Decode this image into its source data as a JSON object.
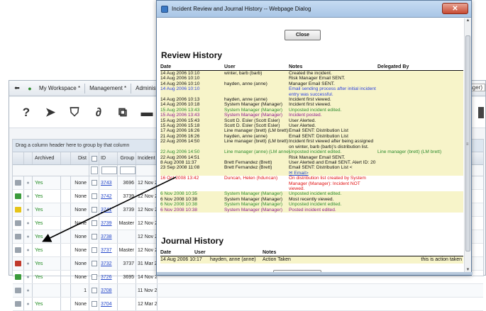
{
  "background_app": {
    "nav": {
      "items": [
        "My Workspace *",
        "Management *",
        "Administration"
      ],
      "right_tab": "ager)"
    },
    "toolbar": {
      "icons": [
        "link-icon",
        "send-icon",
        "bookmark-icon",
        "attach-icon",
        "copy-icon",
        "archive-icon",
        "delete-icon"
      ]
    },
    "grid": {
      "drag_hint": "Drag a column header here to group by that column",
      "headers": {
        "archived": "Archived",
        "dist": "Dist",
        "id": "ID",
        "group": "Group",
        "date": "Incident"
      },
      "rows": [
        {
          "archived": "Yes",
          "dist": "None",
          "id": "3743",
          "group": "3696",
          "date": "12 Nov 2"
        },
        {
          "archived": "Yes",
          "dist": "None",
          "id": "3742",
          "group": "3739",
          "date": "12 Nov 2"
        },
        {
          "archived": "Yes",
          "dist": "None",
          "id": "3741",
          "group": "3739",
          "date": "12 Nov 2"
        },
        {
          "archived": "Yes",
          "dist": "None",
          "id": "3739",
          "group": "Master",
          "date": "12 Nov 2"
        },
        {
          "archived": "Yes",
          "dist": "None",
          "id": "3738",
          "group": "",
          "date": "12 Nov 2"
        },
        {
          "archived": "Yes",
          "dist": "None",
          "id": "3737",
          "group": "Master",
          "date": "12 Nov 2"
        },
        {
          "archived": "Yes",
          "dist": "None",
          "id": "3732",
          "group": "3737",
          "date": "31 Mar 2"
        },
        {
          "archived": "Yes",
          "dist": "None",
          "id": "3726",
          "group": "3695",
          "date": "14 Nov 2"
        },
        {
          "archived": "",
          "dist": "1",
          "id": "3708",
          "group": "",
          "date": "11 Nov 2"
        },
        {
          "archived": "Yes",
          "dist": "None",
          "id": "3704",
          "group": "",
          "date": "12 Mar 2"
        }
      ]
    }
  },
  "dialog": {
    "title": "Incident Review and Journal History -- Webpage Dialog",
    "close_button": "Close",
    "review": {
      "heading": "Review History",
      "columns": {
        "date": "Date",
        "user": "User",
        "notes": "Notes",
        "delegated": "Delegated By"
      },
      "rows": [
        {
          "date": "14 Aug 2006 10:10",
          "user": "winter, barb (barb)",
          "notes": "Created the incident.",
          "delegated": "",
          "color": "#111111"
        },
        {
          "date": "14 Aug 2006 10:10",
          "user": "",
          "notes": "Risk Manager Email SENT.",
          "delegated": "",
          "color": "#111111"
        },
        {
          "date": "14 Aug 2006 10:10",
          "user": "hayden, anne (anne)",
          "notes": "Manager Email SENT.",
          "delegated": "",
          "color": "#111111"
        },
        {
          "date": "14 Aug 2006 10:10",
          "user": "",
          "notes": "Email sending process after initial incident entry was successful.",
          "delegated": "",
          "color": "#2a3fe0"
        },
        {
          "date": "14 Aug 2006 10:13",
          "user": "hayden, anne (anne)",
          "notes": "Incident first viewed.",
          "delegated": "",
          "color": "#111111"
        },
        {
          "date": "14 Aug 2006 10:18",
          "user": "System Manager (Manager)",
          "notes": "Incident first viewed.",
          "delegated": "",
          "color": "#111111"
        },
        {
          "date": "15 Aug 2006 13:43",
          "user": "System Manager (Manager)",
          "notes": "Unposted incident edited.",
          "delegated": "",
          "color": "#2d8a2d"
        },
        {
          "date": "15 Aug 2006 13:43",
          "user": "System Manager (Manager)",
          "notes": "Incident posted.",
          "delegated": "",
          "color": "#8e1c8e"
        },
        {
          "date": "15 Aug 2006 15:43",
          "user": "Scott D. Esler (Scott Esler)",
          "notes": "User Alerted.",
          "delegated": "",
          "color": "#111111"
        },
        {
          "date": "15 Aug 2006 15:18",
          "user": "Scott D. Esler (Scott Esler)",
          "notes": "User Alerted.",
          "delegated": "",
          "color": "#111111"
        },
        {
          "date": "17 Aug 2006 16:26",
          "user": "Line manager (brett) (LM brett)",
          "notes": "Email SENT: Distribution List",
          "delegated": "",
          "color": "#111111"
        },
        {
          "date": "21 Aug 2006 16:26",
          "user": "hayden, anne (anne)",
          "notes": "Email SENT: Distribution List",
          "delegated": "",
          "color": "#111111"
        },
        {
          "date": "22 Aug 2006 14:50",
          "user": "Line manager (brett) (LM brett)",
          "notes": "Incident first viewed after being assigned on winter, barb (barb)'s distribution list.",
          "delegated": "",
          "color": "#111111"
        },
        {
          "date": "22 Aug 2006 14:50",
          "user": "Line manager (anne) (LM anne)",
          "notes": "Unposted incident edited.",
          "delegated": "Line manager (brett) (LM brett)",
          "color": "#2d8a2d"
        },
        {
          "date": "22 Aug 2006 14:51",
          "user": "",
          "notes": "Risk Manager Email SENT.",
          "delegated": "",
          "color": "#111111"
        },
        {
          "date": "8 Aug 2008 11:37",
          "user": "Brett Fernandez (Brett)",
          "notes": "User Alerted and Email SENT. Alert ID: 20",
          "delegated": "",
          "color": "#111111"
        },
        {
          "date": "23 Sep 2008 11:08",
          "user": "Brett Fernandez (Brett)",
          "notes": "Email SENT: Distribution List <",
          "notes_link": "Email>",
          "delegated": "",
          "color": "#111111"
        },
        {
          "date": "16 Oct 2008 13:42",
          "user": "Duncan, Helen (hduncan)",
          "notes": "On distribution list created by System Manager (Manager): Incident NOT viewed.",
          "delegated": "",
          "color": "#e01010"
        },
        {
          "date": "6 Nov 2008 10:35",
          "user": "System Manager (Manager)",
          "notes": "Unposted incident edited.",
          "delegated": "",
          "color": "#2d8a2d"
        },
        {
          "date": "6 Nov 2008 10:38",
          "user": "System Manager (Manager)",
          "notes": "Most recently viewed.",
          "delegated": "",
          "color": "#111111"
        },
        {
          "date": "6 Nov 2008 10:38",
          "user": "System Manager (Manager)",
          "notes": "Unposted incident edited.",
          "delegated": "",
          "color": "#2d8a2d"
        },
        {
          "date": "6 Nov 2008 10:38",
          "user": "System Manager (Manager)",
          "notes": "Posted incident edited.",
          "delegated": "",
          "color": "#8e1c8e"
        }
      ]
    },
    "journal": {
      "heading": "Journal History",
      "columns": {
        "date": "Date",
        "user": "User",
        "notes": "Notes"
      },
      "rows": [
        {
          "date": "14 Aug 2006 10:17",
          "user": "hayden, anne (anne)",
          "notes": "Action Taken",
          "extra": "this is action taken"
        }
      ]
    }
  }
}
